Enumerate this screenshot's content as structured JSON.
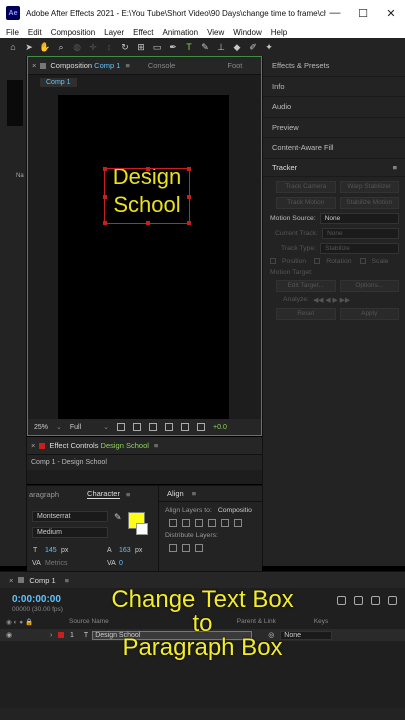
{
  "window": {
    "title": "Adobe After Effects 2021 - E:\\You Tube\\Short Video\\90 Days\\change time to frame\\ch...",
    "logo": "Ae",
    "minimize": "—",
    "maximize": "☐",
    "close": "✕"
  },
  "menu": [
    "File",
    "Edit",
    "Composition",
    "Layer",
    "Effect",
    "Animation",
    "View",
    "Window",
    "Help"
  ],
  "composition_panel": {
    "close": "×",
    "tab_prefix": "Composition",
    "tab_name": "Comp 1",
    "menu": "≡",
    "other_tabs": [
      "Console",
      "Foot"
    ],
    "subtab": "Comp 1",
    "text_line1": "Design",
    "text_line2": "School",
    "zoom": "25%",
    "resolution": "Full",
    "offset": "+0.0"
  },
  "right_panel": {
    "items": [
      "Effects & Presets",
      "Info",
      "Audio",
      "Preview",
      "Content-Aware Fill"
    ],
    "tracker": {
      "title": "Tracker",
      "menu": "≡",
      "buttons_row1": [
        "Track Camera",
        "Warp Stabilizer"
      ],
      "buttons_row2": [
        "Track Motion",
        "Stabilize Motion"
      ],
      "motion_source_label": "Motion Source:",
      "motion_source_value": "None",
      "current_track_label": "Current Track:",
      "current_track_value": "None",
      "track_type_label": "Track Type:",
      "track_type_value": "Stabilize",
      "checks": [
        "Position",
        "Rotation",
        "Scale"
      ],
      "motion_target": "Motion Target:",
      "edit_target": "Edit Target...",
      "options": "Options...",
      "analyze": "Analyze:",
      "analyze_icons": "◀◀  ◀  ▶  ▶▶",
      "reset": "Reset",
      "apply": "Apply"
    }
  },
  "effect_controls": {
    "close": "×",
    "tab_prefix": "Effect Controls",
    "tab_name": "Design School",
    "menu": "≡",
    "sub": "Comp 1 - Design School"
  },
  "character_panel": {
    "tab_paragraph": "aragraph",
    "tab_character": "Character",
    "menu": "≡",
    "font": "Montserrat",
    "style": "Medium",
    "size_value": "145",
    "size_unit": "px",
    "leading_value": "163",
    "leading_unit": "px",
    "kerning_label": "Metrics",
    "tracking_value": "0",
    "fill_color": "#ffff16"
  },
  "align_panel": {
    "title": "Align",
    "menu": "≡",
    "align_to_label": "Align Layers to:",
    "align_to_value": "Compositio",
    "distribute_label": "Distribute Layers:"
  },
  "timeline": {
    "tab_close": "×",
    "tab_name": "Comp 1",
    "menu": "≡",
    "timecode": "0:00:00:00",
    "fps": "00000 (30.00 fps)",
    "header_source": "Source Name",
    "header_parent": "Parent & Link",
    "header_keys": "Keys",
    "layer_number": "1",
    "layer_type": "T",
    "layer_name": "Design School",
    "parent_value": "None"
  },
  "caption": {
    "line1": "Change Text Box",
    "line2": "to",
    "line3": "Paragraph Box"
  }
}
